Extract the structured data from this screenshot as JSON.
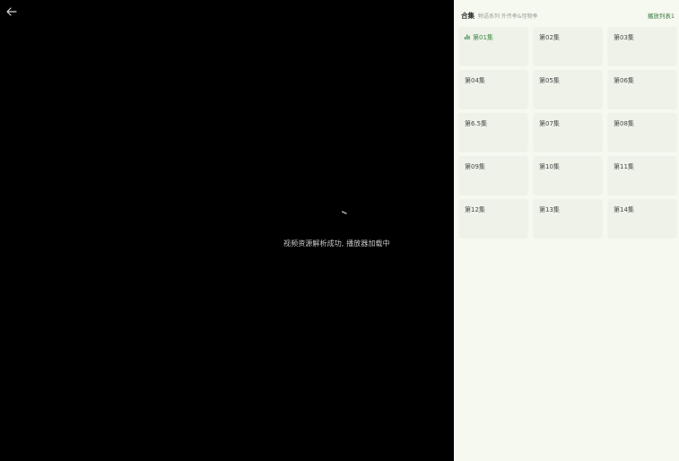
{
  "player": {
    "back_icon": "arrow-left-icon",
    "spinner_icon": "loading-spinner-icon",
    "status_text": "视频资源解析成功, 播放器加载中"
  },
  "panel": {
    "title": "合集",
    "subtitle": "物语系列 外传季&怪物季",
    "playlist_link": "播放列表1",
    "active_color": "#3d8a48",
    "episodes": [
      {
        "label": "第01集",
        "active": true
      },
      {
        "label": "第02集",
        "active": false
      },
      {
        "label": "第03集",
        "active": false
      },
      {
        "label": "第04集",
        "active": false
      },
      {
        "label": "第05集",
        "active": false
      },
      {
        "label": "第06集",
        "active": false
      },
      {
        "label": "第6.5集",
        "active": false
      },
      {
        "label": "第07集",
        "active": false
      },
      {
        "label": "第08集",
        "active": false
      },
      {
        "label": "第09集",
        "active": false
      },
      {
        "label": "第10集",
        "active": false
      },
      {
        "label": "第11集",
        "active": false
      },
      {
        "label": "第12集",
        "active": false
      },
      {
        "label": "第13集",
        "active": false
      },
      {
        "label": "第14集",
        "active": false
      }
    ]
  }
}
